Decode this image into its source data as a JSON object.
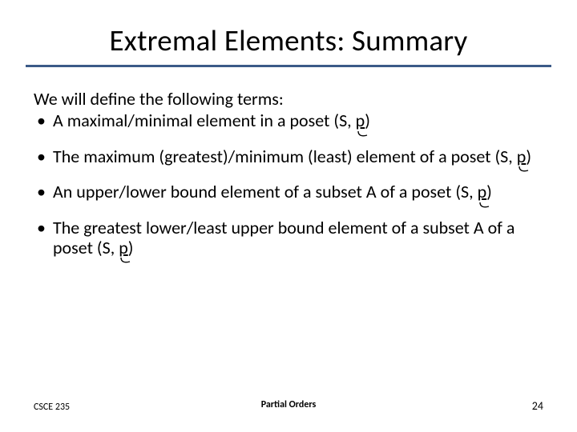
{
  "title": "Extremal Elements: Summary",
  "intro": "We will define the following terms:",
  "bullets": [
    {
      "pre": "A maximal/minimal element in a poset (S, ",
      "post": ")"
    },
    {
      "pre": "The maximum (greatest)/minimum (least) element of a poset (S, ",
      "post": ")"
    },
    {
      "pre": "An upper/lower bound element of a subset A of a poset (S, ",
      "post": ")"
    },
    {
      "pre": "The greatest lower/least upper bound element of a subset A of a poset (S, ",
      "post": ")"
    }
  ],
  "prec_symbol": "p",
  "footer": {
    "left": "CSCE 235",
    "center": "Partial Orders",
    "right": "24"
  }
}
